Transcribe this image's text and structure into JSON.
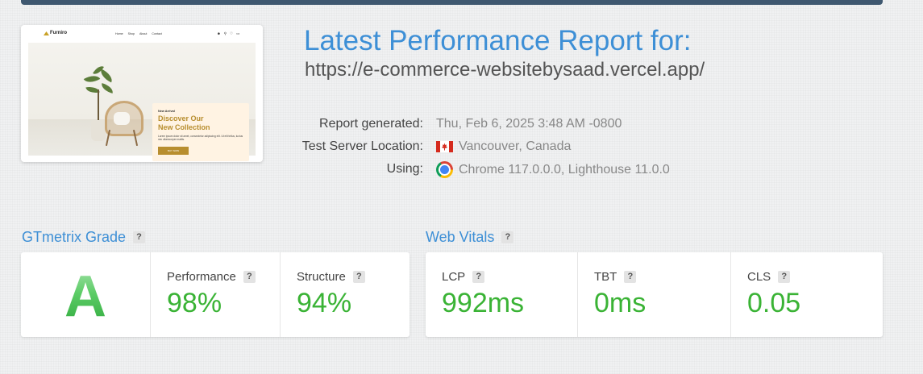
{
  "report": {
    "title": "Latest Performance Report for:",
    "url": "https://e-commerce-websitebysaad.vercel.app/",
    "meta": [
      {
        "label": "Report generated:",
        "value": "Thu, Feb 6, 2025 3:48 AM -0800",
        "icon": ""
      },
      {
        "label": "Test Server Location:",
        "value": "Vancouver, Canada",
        "icon": "canada-flag-icon"
      },
      {
        "label": "Using:",
        "value": "Chrome 117.0.0.0, Lighthouse 11.0.0",
        "icon": "chrome-icon"
      }
    ]
  },
  "thumbnail": {
    "brand": "Furniro",
    "nav_links": [
      "Home",
      "Shop",
      "About",
      "Contact"
    ],
    "hero_kicker": "New Arrival",
    "hero_heading_line1": "Discover Our",
    "hero_heading_line2": "New Collection",
    "hero_body": "Lorem ipsum dolor sit amet, consectetur adipiscing elit. Ut elit tellus, luctus nec ullamcorper mattis.",
    "hero_button": "BUY NOW"
  },
  "grade": {
    "title": "GTmetrix Grade",
    "help": "?",
    "letter": "A",
    "performance_label": "Performance",
    "performance_value": "98%",
    "structure_label": "Structure",
    "structure_value": "94%"
  },
  "vitals": {
    "title": "Web Vitals",
    "help": "?",
    "items": [
      {
        "label": "LCP",
        "value": "992ms"
      },
      {
        "label": "TBT",
        "value": "0ms"
      },
      {
        "label": "CLS",
        "value": "0.05"
      }
    ]
  },
  "colors": {
    "accent_blue": "#3d8fd6",
    "good_green": "#3ab335",
    "banner": "#3f5870"
  }
}
